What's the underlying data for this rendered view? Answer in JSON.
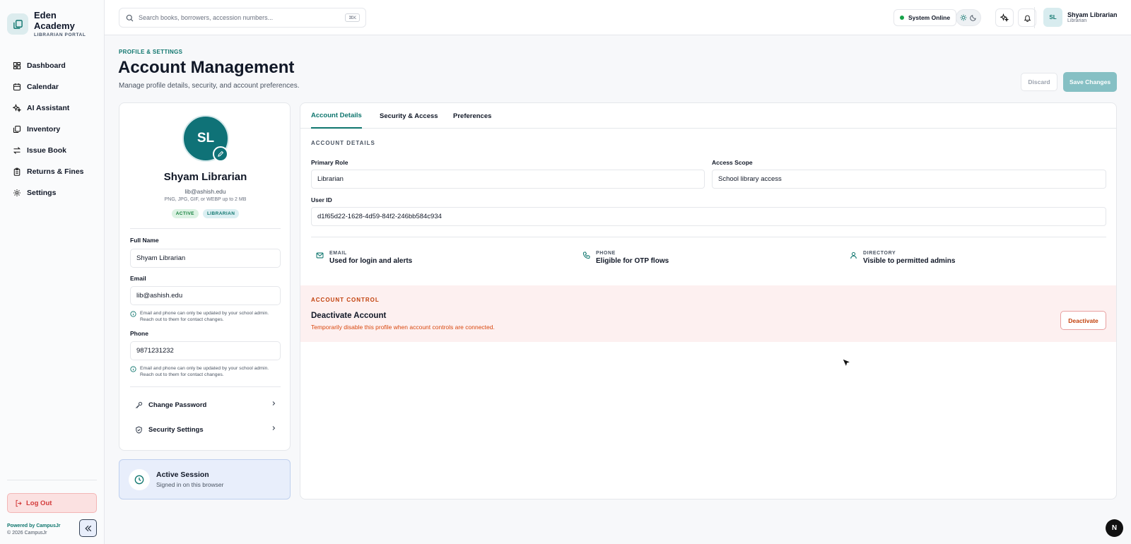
{
  "brand": {
    "name_line1": "Eden",
    "name_line2": "Academy",
    "subtitle": "LIBRARIAN PORTAL"
  },
  "sidebar": {
    "items": [
      {
        "label": "Dashboard",
        "icon": "dashboard-icon"
      },
      {
        "label": "Calendar",
        "icon": "calendar-icon"
      },
      {
        "label": "AI Assistant",
        "icon": "sparkle-icon"
      },
      {
        "label": "Inventory",
        "icon": "books-icon"
      },
      {
        "label": "Issue Book",
        "icon": "swap-icon"
      },
      {
        "label": "Returns & Fines",
        "icon": "clipboard-icon"
      },
      {
        "label": "Settings",
        "icon": "gear-icon"
      }
    ],
    "logout_label": "Log Out",
    "powered_by": "Powered by CampusJr",
    "copyright": "© 2026 CampusJr"
  },
  "topbar": {
    "search_placeholder": "Search books, borrowers, accession numbers...",
    "shortcut": "⌘K",
    "status": "System Online",
    "user_initials": "SL",
    "user_name": "Shyam Librarian",
    "user_role": "Librarian"
  },
  "header": {
    "eyebrow": "PROFILE & SETTINGS",
    "title": "Account Management",
    "subtitle": "Manage profile details, security, and account preferences.",
    "discard_label": "Discard",
    "save_label": "Save Changes"
  },
  "profile": {
    "initials": "SL",
    "name": "Shyam Librarian",
    "email": "lib@ashish.edu",
    "upload_hint": "PNG, JPG, GIF, or WEBP up to 2 MB",
    "badges": [
      "ACTIVE",
      "LIBRARIAN"
    ],
    "full_name_label": "Full Name",
    "full_name": "Shyam Librarian",
    "email_label": "Email",
    "email_value": "lib@ashish.edu",
    "contact_note": "Email and phone can only be updated by your school admin. Reach out to them for contact changes.",
    "phone_label": "Phone",
    "phone_value": "9871231232",
    "change_password_label": "Change Password",
    "security_settings_label": "Security Settings"
  },
  "session": {
    "title": "Active Session",
    "subtitle": "Signed in on this browser"
  },
  "tabs": [
    {
      "label": "Account Details",
      "active": true
    },
    {
      "label": "Security & Access",
      "active": false
    },
    {
      "label": "Preferences",
      "active": false
    }
  ],
  "account_details": {
    "section_title": "ACCOUNT DETAILS",
    "primary_role_label": "Primary Role",
    "primary_role": "Librarian",
    "access_scope_label": "Access Scope",
    "access_scope": "School library access",
    "user_id_label": "User ID",
    "user_id": "d1f65d22-1628-4d59-84f2-246bb584c934",
    "info": [
      {
        "key": "EMAIL",
        "value": "Used for login and alerts",
        "icon": "mail-icon"
      },
      {
        "key": "PHONE",
        "value": "Eligible for OTP flows",
        "icon": "phone-icon"
      },
      {
        "key": "DIRECTORY",
        "value": "Visible to permitted admins",
        "icon": "user-icon"
      }
    ]
  },
  "account_control": {
    "section_title": "ACCOUNT CONTROL",
    "heading": "Deactivate Account",
    "description": "Temporarily disable this profile when account controls are connected.",
    "button_label": "Deactivate"
  },
  "floating": {
    "next_badge": "N"
  },
  "colors": {
    "accent": "#0f766e",
    "danger": "#c2410c",
    "save_disabled": "#86c0c4"
  }
}
